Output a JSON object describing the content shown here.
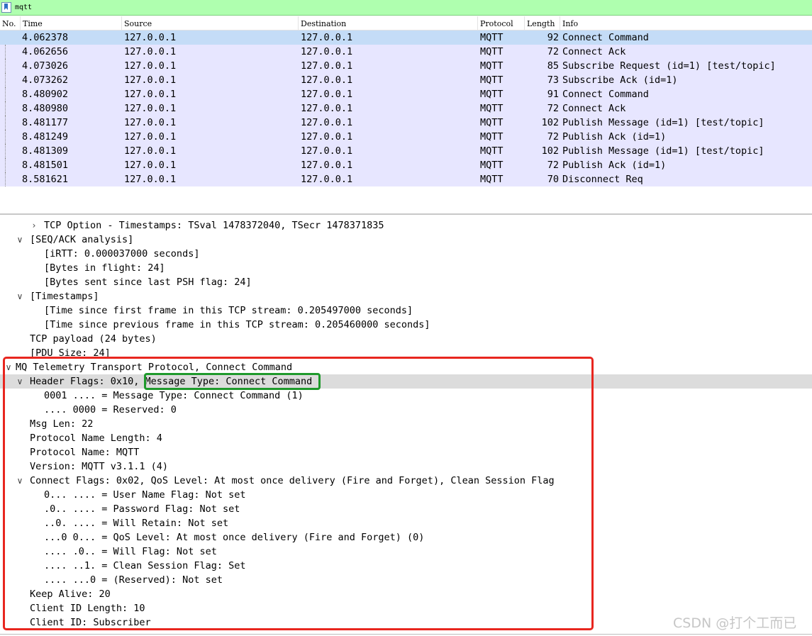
{
  "filter": {
    "value": "mqtt"
  },
  "columns": [
    "No.",
    "Time",
    "Source",
    "Destination",
    "Protocol",
    "Length",
    "Info"
  ],
  "packets": [
    {
      "time": "4.062378",
      "src": "127.0.0.1",
      "dst": "127.0.0.1",
      "proto": "MQTT",
      "len": "92",
      "info": "Connect Command"
    },
    {
      "time": "4.062656",
      "src": "127.0.0.1",
      "dst": "127.0.0.1",
      "proto": "MQTT",
      "len": "72",
      "info": "Connect Ack"
    },
    {
      "time": "4.073026",
      "src": "127.0.0.1",
      "dst": "127.0.0.1",
      "proto": "MQTT",
      "len": "85",
      "info": "Subscribe Request (id=1) [test/topic]"
    },
    {
      "time": "4.073262",
      "src": "127.0.0.1",
      "dst": "127.0.0.1",
      "proto": "MQTT",
      "len": "73",
      "info": "Subscribe Ack (id=1)"
    },
    {
      "time": "8.480902",
      "src": "127.0.0.1",
      "dst": "127.0.0.1",
      "proto": "MQTT",
      "len": "91",
      "info": "Connect Command"
    },
    {
      "time": "8.480980",
      "src": "127.0.0.1",
      "dst": "127.0.0.1",
      "proto": "MQTT",
      "len": "72",
      "info": "Connect Ack"
    },
    {
      "time": "8.481177",
      "src": "127.0.0.1",
      "dst": "127.0.0.1",
      "proto": "MQTT",
      "len": "102",
      "info": "Publish Message (id=1) [test/topic]"
    },
    {
      "time": "8.481249",
      "src": "127.0.0.1",
      "dst": "127.0.0.1",
      "proto": "MQTT",
      "len": "72",
      "info": "Publish Ack (id=1)"
    },
    {
      "time": "8.481309",
      "src": "127.0.0.1",
      "dst": "127.0.0.1",
      "proto": "MQTT",
      "len": "102",
      "info": "Publish Message (id=1) [test/topic]"
    },
    {
      "time": "8.481501",
      "src": "127.0.0.1",
      "dst": "127.0.0.1",
      "proto": "MQTT",
      "len": "72",
      "info": "Publish Ack (id=1)"
    },
    {
      "time": "8.581621",
      "src": "127.0.0.1",
      "dst": "127.0.0.1",
      "proto": "MQTT",
      "len": "70",
      "info": "Disconnect Req"
    }
  ],
  "details": [
    {
      "level": 2,
      "toggle": "collapsed",
      "text": "TCP Option - Timestamps: TSval 1478372040, TSecr 1478371835"
    },
    {
      "level": 1,
      "toggle": "expanded",
      "text": "[SEQ/ACK analysis]"
    },
    {
      "level": 2,
      "toggle": "none",
      "text": "[iRTT: 0.000037000 seconds]"
    },
    {
      "level": 2,
      "toggle": "none",
      "text": "[Bytes in flight: 24]"
    },
    {
      "level": 2,
      "toggle": "none",
      "text": "[Bytes sent since last PSH flag: 24]"
    },
    {
      "level": 1,
      "toggle": "expanded",
      "text": "[Timestamps]"
    },
    {
      "level": 2,
      "toggle": "none",
      "text": "[Time since first frame in this TCP stream: 0.205497000 seconds]"
    },
    {
      "level": 2,
      "toggle": "none",
      "text": "[Time since previous frame in this TCP stream: 0.205460000 seconds]"
    },
    {
      "level": 1,
      "toggle": "none",
      "text": "TCP payload (24 bytes)"
    },
    {
      "level": 1,
      "toggle": "none",
      "text": "[PDU Size: 24]"
    },
    {
      "level": 0,
      "toggle": "expanded",
      "text": "MQ Telemetry Transport Protocol, Connect Command"
    },
    {
      "level": 1,
      "toggle": "expanded",
      "text": "Header Flags: 0x10, Message Type: Connect Command",
      "highlight": true
    },
    {
      "level": 2,
      "toggle": "none",
      "text": "0001 .... = Message Type: Connect Command (1)"
    },
    {
      "level": 2,
      "toggle": "none",
      "text": ".... 0000 = Reserved: 0"
    },
    {
      "level": 1,
      "toggle": "none",
      "text": "Msg Len: 22"
    },
    {
      "level": 1,
      "toggle": "none",
      "text": "Protocol Name Length: 4"
    },
    {
      "level": 1,
      "toggle": "none",
      "text": "Protocol Name: MQTT"
    },
    {
      "level": 1,
      "toggle": "none",
      "text": "Version: MQTT v3.1.1 (4)"
    },
    {
      "level": 1,
      "toggle": "expanded",
      "text": "Connect Flags: 0x02, QoS Level: At most once delivery (Fire and Forget), Clean Session Flag"
    },
    {
      "level": 2,
      "toggle": "none",
      "text": "0... .... = User Name Flag: Not set"
    },
    {
      "level": 2,
      "toggle": "none",
      "text": ".0.. .... = Password Flag: Not set"
    },
    {
      "level": 2,
      "toggle": "none",
      "text": "..0. .... = Will Retain: Not set"
    },
    {
      "level": 2,
      "toggle": "none",
      "text": "...0 0... = QoS Level: At most once delivery (Fire and Forget) (0)"
    },
    {
      "level": 2,
      "toggle": "none",
      "text": ".... .0.. = Will Flag: Not set"
    },
    {
      "level": 2,
      "toggle": "none",
      "text": ".... ..1. = Clean Session Flag: Set"
    },
    {
      "level": 2,
      "toggle": "none",
      "text": ".... ...0 = (Reserved): Not set"
    },
    {
      "level": 1,
      "toggle": "none",
      "text": "Keep Alive: 20"
    },
    {
      "level": 1,
      "toggle": "none",
      "text": "Client ID Length: 10"
    },
    {
      "level": 1,
      "toggle": "none",
      "text": "Client ID: Subscriber"
    }
  ],
  "watermark": "CSDN @打个工而已",
  "colors": {
    "filter_bg": "#afffaf",
    "row_bg": "#e7e6ff",
    "selected_bg": "#c4dcf7",
    "annot_red": "#e8261f",
    "annot_green": "#1f9a2c"
  }
}
